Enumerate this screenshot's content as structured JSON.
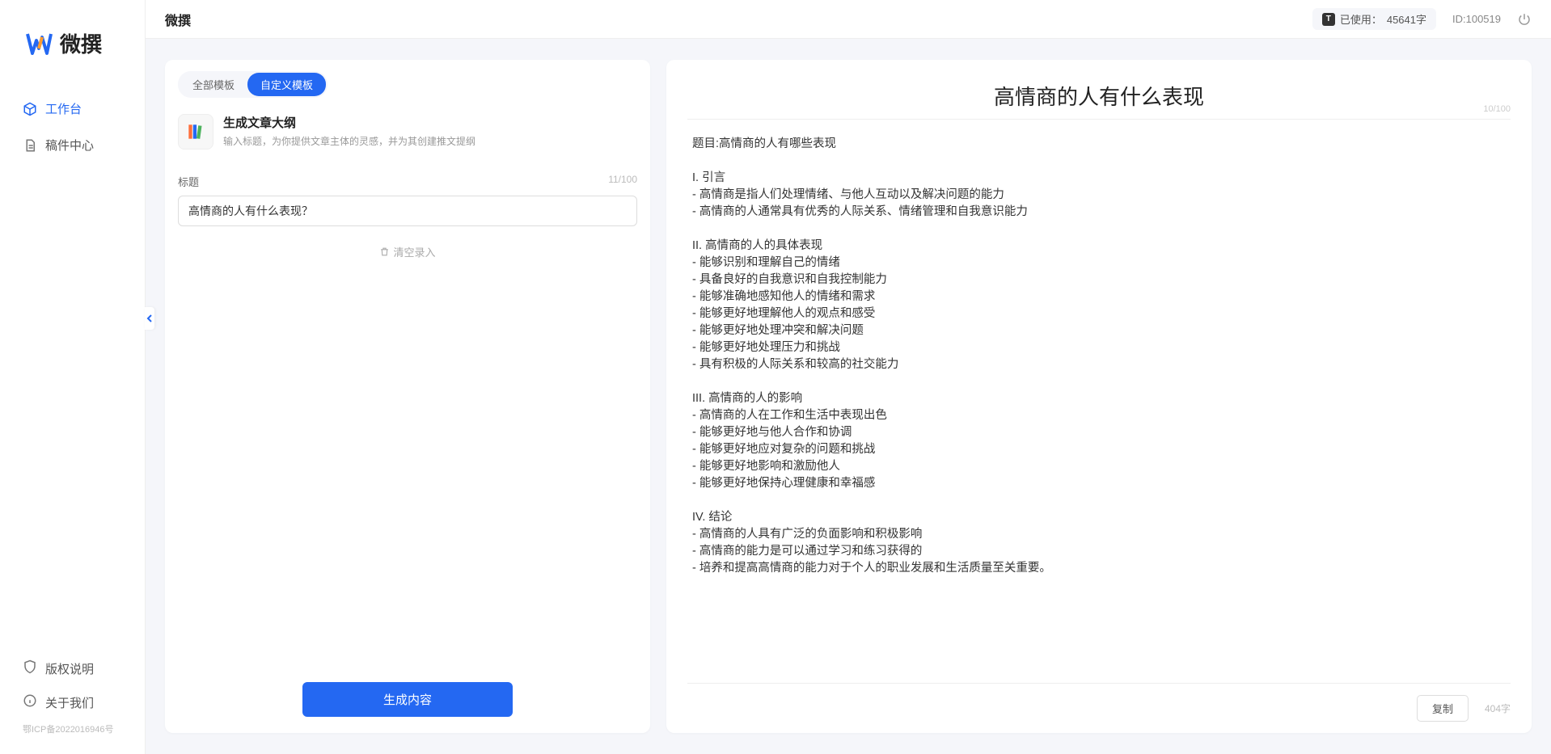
{
  "brand": "微撰",
  "sidebar": {
    "nav": [
      {
        "label": "工作台",
        "active": true
      },
      {
        "label": "稿件中心",
        "active": false
      }
    ],
    "footer": [
      {
        "label": "版权说明"
      },
      {
        "label": "关于我们"
      }
    ],
    "icp": "鄂ICP备2022016946号"
  },
  "topbar": {
    "title": "微撰",
    "usage_label": "已使用：",
    "usage_value": "45641字",
    "id_label": "ID:100519"
  },
  "left": {
    "tabs": [
      {
        "label": "全部模板",
        "active": false
      },
      {
        "label": "自定义模板",
        "active": true
      }
    ],
    "template": {
      "title": "生成文章大纲",
      "desc": "输入标题，为你提供文章主体的灵感，并为其创建推文提纲"
    },
    "field_label": "标题",
    "char_count": "11/100",
    "title_value": "高情商的人有什么表现？",
    "clear_label": "清空录入",
    "generate_label": "生成内容"
  },
  "output": {
    "title": "高情商的人有什么表现",
    "title_count": "10/100",
    "body": "题目:高情商的人有哪些表现\n\nI. 引言\n- 高情商是指人们处理情绪、与他人互动以及解决问题的能力\n- 高情商的人通常具有优秀的人际关系、情绪管理和自我意识能力\n\nII. 高情商的人的具体表现\n- 能够识别和理解自己的情绪\n- 具备良好的自我意识和自我控制能力\n- 能够准确地感知他人的情绪和需求\n- 能够更好地理解他人的观点和感受\n- 能够更好地处理冲突和解决问题\n- 能够更好地处理压力和挑战\n- 具有积极的人际关系和较高的社交能力\n\nIII. 高情商的人的影响\n- 高情商的人在工作和生活中表现出色\n- 能够更好地与他人合作和协调\n- 能够更好地应对复杂的问题和挑战\n- 能够更好地影响和激励他人\n- 能够更好地保持心理健康和幸福感\n\nIV. 结论\n- 高情商的人具有广泛的负面影响和积极影响\n- 高情商的能力是可以通过学习和练习获得的\n- 培养和提高高情商的能力对于个人的职业发展和生活质量至关重要。",
    "copy_label": "复制",
    "word_count": "404字"
  }
}
